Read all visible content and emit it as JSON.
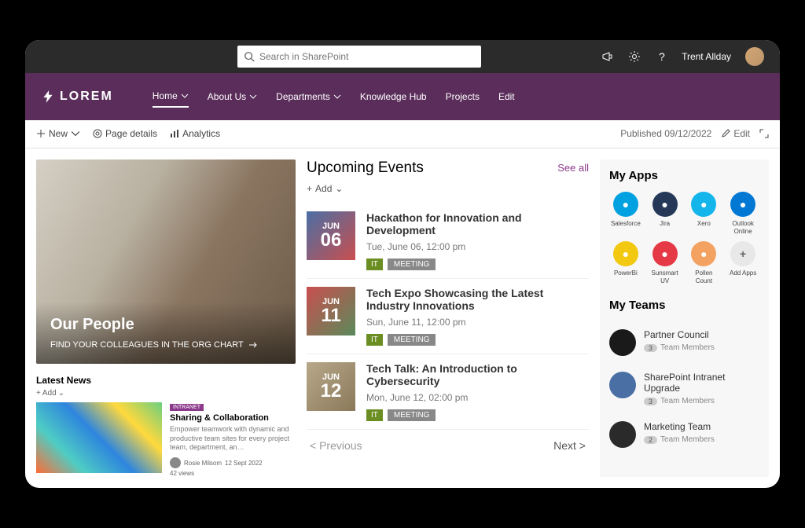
{
  "topbar": {
    "search_placeholder": "Search in SharePoint",
    "username": "Trent Allday"
  },
  "nav": {
    "logo": "LOREM",
    "items": [
      "Home",
      "About Us",
      "Departments",
      "Knowledge Hub",
      "Projects",
      "Edit"
    ]
  },
  "subbar": {
    "new": "New",
    "page_details": "Page details",
    "analytics": "Analytics",
    "published": "Published 09/12/2022",
    "edit": "Edit"
  },
  "hero": {
    "title": "Our People",
    "subtitle": "FIND YOUR COLLEAGUES IN THE ORG CHART"
  },
  "news": {
    "header": "Latest News",
    "add": "Add",
    "tag": "INTRANET",
    "title": "Sharing & Collaboration",
    "desc": "Empower teamwork with dynamic and productive team sites for every project team, department, an…",
    "author": "Rosie Milsom",
    "date": "12 Sept 2022",
    "views": "42 views"
  },
  "events": {
    "title": "Upcoming Events",
    "see_all": "See all",
    "add": "Add",
    "items": [
      {
        "month": "JUN",
        "day": "06",
        "name": "Hackathon for Innovation and Development",
        "time": "Tue, June 06, 12:00 pm",
        "tags": [
          "IT",
          "MEETING"
        ]
      },
      {
        "month": "JUN",
        "day": "11",
        "name": "Tech Expo Showcasing the Latest Industry Innovations",
        "time": "Sun, June 11, 12:00 pm",
        "tags": [
          "IT",
          "MEETING"
        ]
      },
      {
        "month": "JUN",
        "day": "12",
        "name": "Tech Talk: An Introduction to Cybersecurity",
        "time": "Mon, June 12, 02:00 pm",
        "tags": [
          "IT",
          "MEETING"
        ]
      }
    ],
    "prev": "Previous",
    "next": "Next"
  },
  "apps": {
    "title": "My Apps",
    "items": [
      {
        "label": "Salesforce",
        "color": "#00a1e0"
      },
      {
        "label": "Jira",
        "color": "#253858"
      },
      {
        "label": "Xero",
        "color": "#13b5ea"
      },
      {
        "label": "Outlook Online",
        "color": "#0078d4"
      },
      {
        "label": "PowerBi",
        "color": "#f2c811"
      },
      {
        "label": "Sunsmart UV",
        "color": "#e63946"
      },
      {
        "label": "Pollen Count",
        "color": "#f4a261"
      },
      {
        "label": "Add Apps",
        "color": "#e8e8e8"
      }
    ]
  },
  "teams": {
    "title": "My Teams",
    "items": [
      {
        "name": "Partner Council",
        "count": "3",
        "label": "Team Members",
        "color": "#1a1a1a"
      },
      {
        "name": "SharePoint Intranet Upgrade",
        "count": "3",
        "label": "Team Members",
        "color": "#4a6fa5"
      },
      {
        "name": "Marketing Team",
        "count": "2",
        "label": "Team Members",
        "color": "#2a2a2a"
      }
    ]
  }
}
